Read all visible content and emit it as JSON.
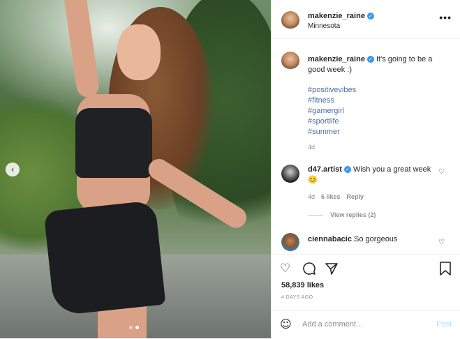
{
  "post": {
    "author": "makenzie_raine",
    "location": "Minnesota",
    "more_icon": "ellipsis-icon",
    "verified_icon": "verified-badge-icon",
    "caption": "It's going to be a good week :)",
    "hashtags": [
      "#positivevibes",
      "#fitness",
      "#gamergirl",
      "#sportlife",
      "#summer"
    ],
    "caption_time": "4d",
    "carousel": {
      "prev_icon": "chevron-left-icon",
      "slide_count": 2,
      "active_slide": 2
    }
  },
  "comments": [
    {
      "user": "d47.artist",
      "text": "Wish you a great week",
      "emoji": "😊",
      "time": "4d",
      "likes": "6 likes",
      "reply": "Reply",
      "view_replies": "View replies (2)"
    },
    {
      "user": "ciennabacic",
      "text": "So gorgeous"
    }
  ],
  "actions": {
    "like_icon": "heart-icon",
    "comment_icon": "comment-icon",
    "share_icon": "paper-plane-icon",
    "save_icon": "bookmark-icon",
    "likes_count": "58,839 likes",
    "date": "4 DAYS AGO"
  },
  "add_comment": {
    "placeholder": "Add a comment...",
    "post_label": "Post",
    "emoji_icon": "smiley-icon"
  },
  "colors": {
    "verified": "#3897f0",
    "hashtag": "#4a6fa5",
    "post_disabled": "#b2dffc",
    "muted": "#8e8e8e"
  }
}
